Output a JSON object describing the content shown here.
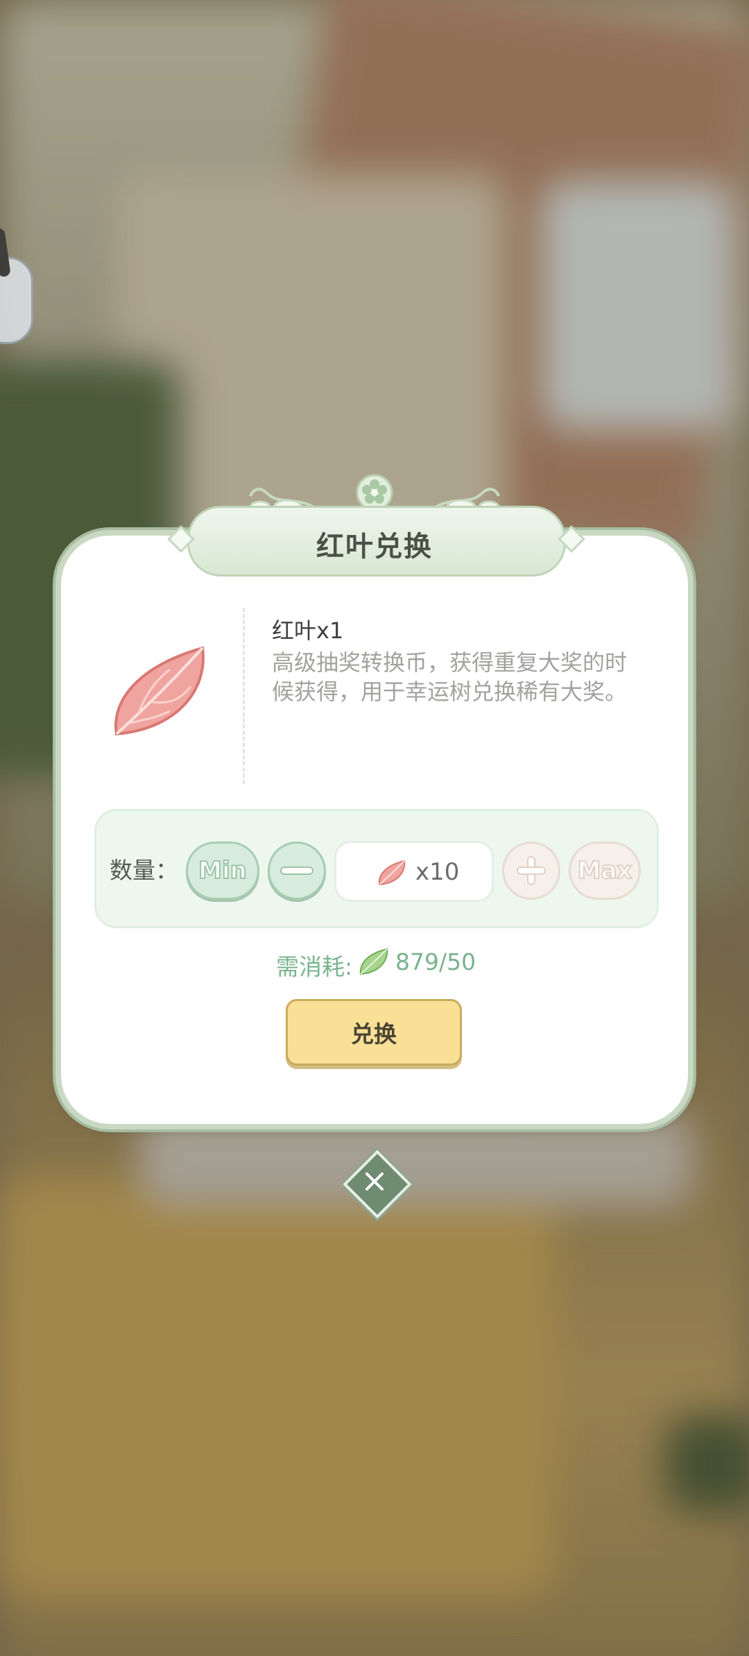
{
  "dialog": {
    "title": "红叶兑换",
    "item": {
      "name": "红叶x1",
      "description": "高级抽奖转换币，获得重复大奖的时候获得，用于幸运树兑换稀有大奖。",
      "icon": "red-leaf-icon"
    },
    "quantity": {
      "label": "数量：",
      "min_label": "Min",
      "max_label": "Max",
      "value": "x10"
    },
    "cost": {
      "label": "需消耗:",
      "icon": "green-leaf-icon",
      "value": "879/50"
    },
    "exchange_label": "兑换"
  },
  "colors": {
    "accent_green": "#79b38d",
    "button_yellow": "#f9e096",
    "panel_green": "#edf7ee"
  }
}
